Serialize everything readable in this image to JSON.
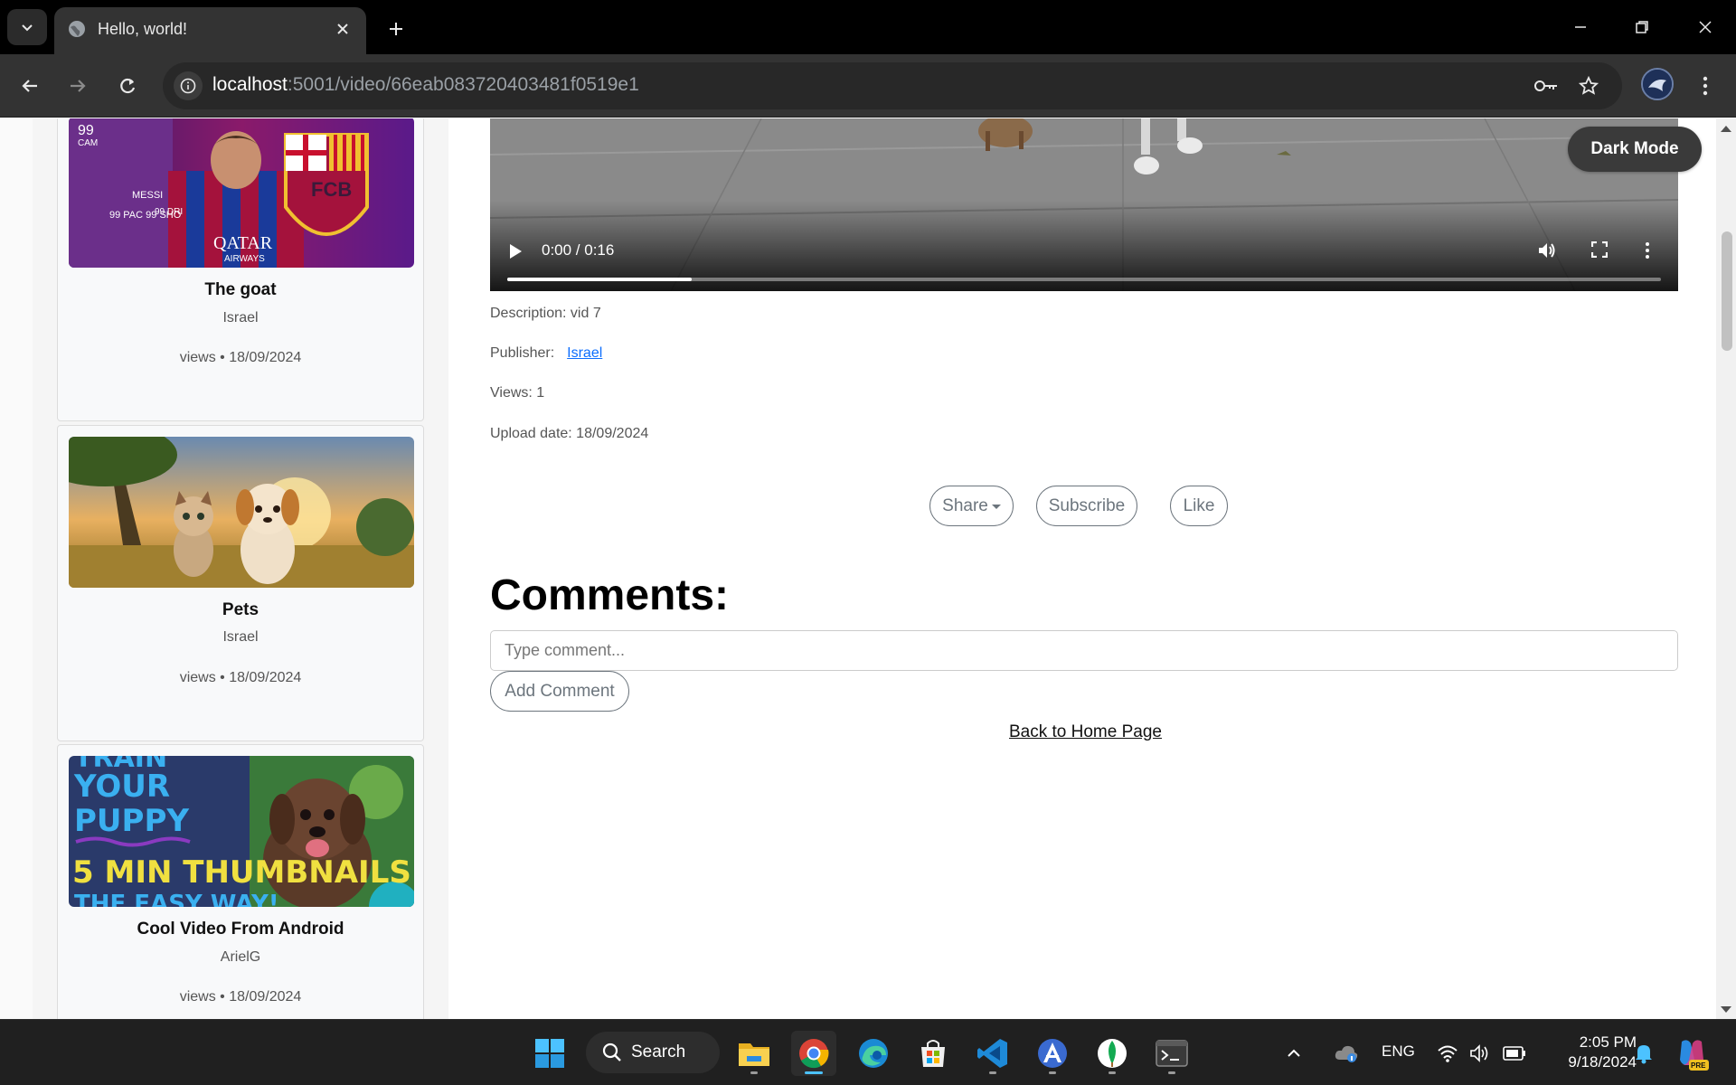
{
  "browser": {
    "tab_title": "Hello, world!",
    "url_host": "localhost",
    "url_path": ":5001/video/66eab083720403481f0519e1"
  },
  "sidebar": {
    "cards": [
      {
        "title": "The goat",
        "author": "Israel",
        "meta": "views • 18/09/2024"
      },
      {
        "title": "Pets",
        "author": "Israel",
        "meta": "views • 18/09/2024"
      },
      {
        "title": "Cool Video From Android",
        "author": "ArielG",
        "meta": "views • 18/09/2024"
      }
    ],
    "thumb_text": {
      "card1_rating": "99",
      "card1_position": "CAM",
      "card1_name": "MESSI",
      "card1_stats": "99 PAC\n99 SHO",
      "card1_stat2": "99 DRI",
      "card1_sponsor": "QATAR",
      "card1_sponsor2": "AIRWAYS",
      "card1_club": "FCB",
      "card3_line1": "TRAIN",
      "card3_line2": "YOUR",
      "card3_line3": "PUPPY",
      "card3_line4": "5 MIN THUMBNAILS",
      "card3_line5": "THE EASY WAY!"
    }
  },
  "video": {
    "time": "0:00 / 0:16",
    "progress_fraction": 0.16
  },
  "dark_mode_label": "Dark Mode",
  "details": {
    "description": "Description: vid 7",
    "publisher_label": "Publisher:",
    "publisher_name": "Israel",
    "views": "Views: 1",
    "upload_date": "Upload date: 18/09/2024"
  },
  "actions": {
    "share": "Share",
    "subscribe": "Subscribe",
    "like": "Like"
  },
  "comments": {
    "heading": "Comments:",
    "placeholder": "Type comment...",
    "add_button": "Add Comment"
  },
  "back_link": "Back to Home Page",
  "taskbar": {
    "search_label": "Search",
    "language": "ENG",
    "time": "2:05 PM",
    "date": "9/18/2024",
    "copilot_badge": "PRE"
  },
  "colors": {
    "accent": "#0d6efd",
    "outline_button": "#6c757d",
    "dark_button": "#3a3a3a",
    "taskbar_active": "#4cc2ff"
  },
  "icons": [
    "tab-search-icon",
    "globe-favicon-icon",
    "close-icon",
    "plus-icon",
    "minimize-icon",
    "restore-icon",
    "back-arrow-icon",
    "forward-arrow-icon",
    "reload-icon",
    "site-info-icon",
    "password-key-icon",
    "bookmark-star-icon",
    "kebab-menu-icon",
    "play-icon",
    "volume-icon",
    "fullscreen-icon",
    "windows-start-icon",
    "search-icon",
    "file-explorer-icon",
    "chrome-icon",
    "edge-icon",
    "store-icon",
    "vscode-icon",
    "app-icon",
    "mongodb-icon",
    "terminal-icon",
    "chevron-up-icon",
    "cloud-icon",
    "wifi-icon",
    "speaker-icon",
    "battery-icon",
    "bell-icon",
    "copilot-icon"
  ]
}
